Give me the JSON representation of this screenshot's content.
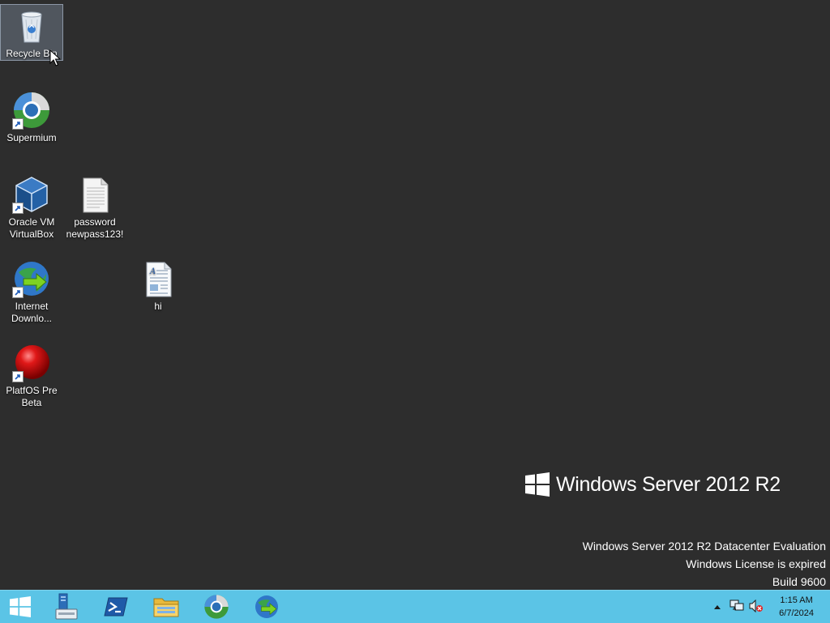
{
  "desktop": {
    "icons": [
      {
        "label": "Recycle Bin",
        "icon": "recycle-bin-icon"
      },
      {
        "label": "Supermium",
        "icon": "supermium-browser-icon"
      },
      {
        "label": "Oracle VM\nVirtualBox",
        "icon": "virtualbox-icon"
      },
      {
        "label": "password\nnewpass123!",
        "icon": "text-file-icon"
      },
      {
        "label": "Internet\nDownlo...",
        "icon": "internet-download-manager-icon"
      },
      {
        "label": "hi",
        "icon": "wordpad-document-icon"
      },
      {
        "label": "PlatfOS Pre\nBeta",
        "icon": "red-sphere-icon"
      }
    ]
  },
  "branding": {
    "product": "Windows Server 2012 R2"
  },
  "watermark": {
    "line1": "Windows Server 2012 R2 Datacenter Evaluation",
    "line2": "Windows License is expired",
    "line3": "Build 9600"
  },
  "taskbar": {
    "pinned": [
      {
        "icon": "start-windows-icon"
      },
      {
        "icon": "server-manager-icon"
      },
      {
        "icon": "powershell-icon"
      },
      {
        "icon": "file-explorer-icon"
      },
      {
        "icon": "supermium-browser-icon"
      },
      {
        "icon": "internet-download-manager-icon"
      }
    ],
    "tray": {
      "icons": [
        "show-hidden-icons-chevron",
        "network-icon",
        "volume-muted-icon"
      ],
      "time": "1:15 AM",
      "date": "6/7/2024"
    }
  },
  "colors": {
    "desktop_bg": "#2d2d2d",
    "taskbar_bg": "#5bc4e6",
    "selection": "#6e7887"
  }
}
